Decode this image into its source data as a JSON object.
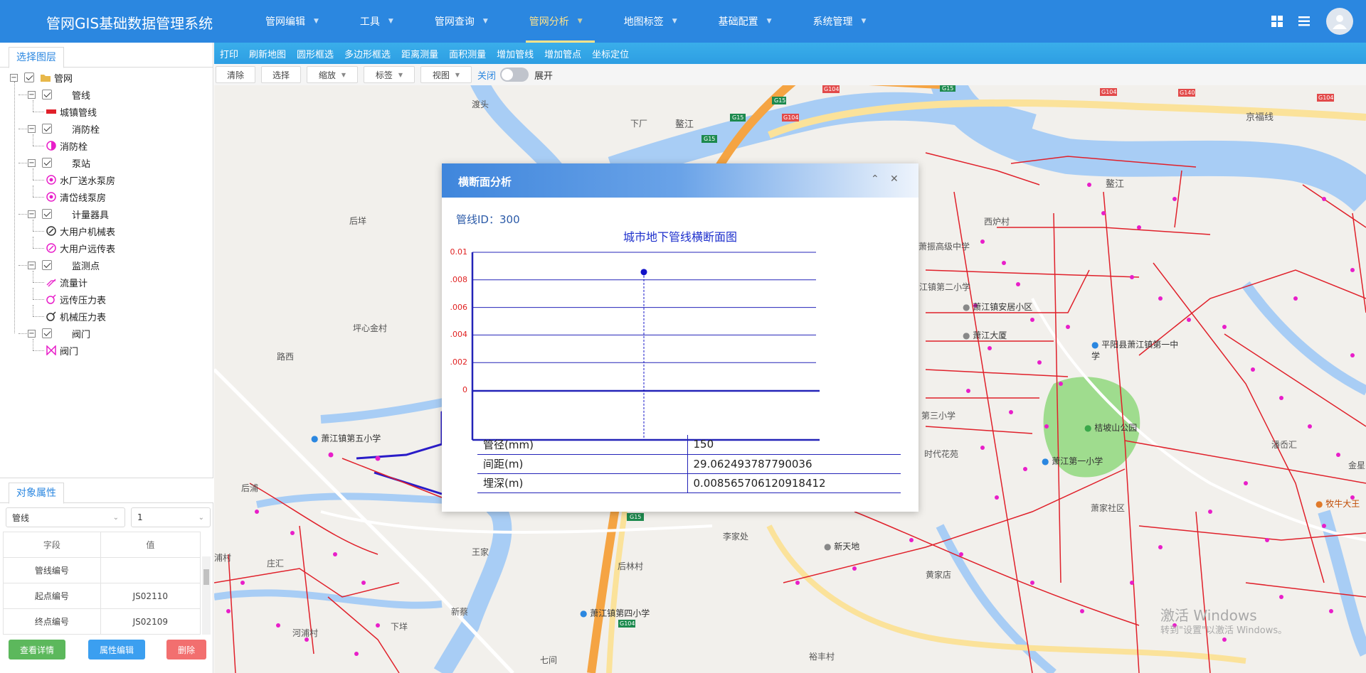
{
  "header": {
    "title": "管网GIS基础数据管理系统",
    "nav": [
      "管网编辑",
      "工具",
      "管网查询",
      "管网分析",
      "地图标签",
      "基础配置",
      "系统管理"
    ],
    "active_nav": "管网分析"
  },
  "toolbar1": [
    "打印",
    "刷新地图",
    "圆形框选",
    "多边形框选",
    "距离测量",
    "面积测量",
    "增加管线",
    "增加管点",
    "坐标定位"
  ],
  "toolbar2": {
    "clear": "清除",
    "select": "选择",
    "zoom": "缩放",
    "label": "标签",
    "view": "视图",
    "switch_off": "关闭",
    "switch_on": "展开"
  },
  "layer_panel": {
    "tab": "选择图层",
    "tree": [
      {
        "label": "管网",
        "level": 0,
        "icon": "folder-icon"
      },
      {
        "label": "管线",
        "level": 1
      },
      {
        "label": "城镇管线",
        "level": 2,
        "icon": "red-line-icon"
      },
      {
        "label": "消防栓",
        "level": 1
      },
      {
        "label": "消防栓",
        "level": 2,
        "icon": "hydrant-icon"
      },
      {
        "label": "泵站",
        "level": 1
      },
      {
        "label": "水厂送水泵房",
        "level": 2,
        "icon": "pump-icon"
      },
      {
        "label": "清岱线泵房",
        "level": 2,
        "icon": "pump-icon"
      },
      {
        "label": "计量器具",
        "level": 1
      },
      {
        "label": "大用户机械表",
        "level": 2,
        "icon": "mech-meter-icon"
      },
      {
        "label": "大用户远传表",
        "level": 2,
        "icon": "remote-meter-icon"
      },
      {
        "label": "监测点",
        "level": 1
      },
      {
        "label": "流量计",
        "level": 2,
        "icon": "flowmeter-icon"
      },
      {
        "label": "远传压力表",
        "level": 2,
        "icon": "remote-gauge-icon"
      },
      {
        "label": "机械压力表",
        "level": 2,
        "icon": "mech-gauge-icon"
      },
      {
        "label": "阀门",
        "level": 1
      },
      {
        "label": "阀门",
        "level": 2,
        "icon": "valve-icon"
      }
    ]
  },
  "attr_panel": {
    "tab": "对象属性",
    "layer_select": "管线",
    "index_select": "1",
    "columns": [
      "字段",
      "值"
    ],
    "rows": [
      [
        "管线编号",
        ""
      ],
      [
        "起点编号",
        "JS02110"
      ],
      [
        "终点编号",
        "JS02109"
      ]
    ],
    "buttons": {
      "details": "查看详情",
      "edit": "属性编辑",
      "delete": "删除"
    }
  },
  "map_labels": [
    "渡头",
    "下厂",
    "鳌江",
    "鳌江",
    "京福线",
    "后垟",
    "坪心金村",
    "路西",
    "萧江镇第五小学",
    "后浦",
    "浦村",
    "庄汇",
    "河浦村",
    "下垟",
    "新蔡",
    "七间",
    "王家",
    "后林村",
    "萧江镇第四小学",
    "李家处",
    "新天地",
    "黄家店",
    "裕丰村",
    "西炉村",
    "萧振高级中学",
    "江镇第二小学",
    "萧江镇安居小区",
    "萧江大厦",
    "平阳县萧江镇第一中学",
    "桔坡山公园",
    "萧江第一小学",
    "第三小学",
    "时代花苑",
    "潘岙汇",
    "金星",
    "牧牛大王",
    "萧家社区"
  ],
  "road_shields": [
    "G15",
    "G15",
    "G15",
    "G15",
    "G104",
    "G104",
    "G104",
    "G140",
    "G104",
    "G15",
    "G104"
  ],
  "watermark": {
    "line1": "激活 Windows",
    "line2": "转到\"设置\"以激活 Windows。"
  },
  "dialog": {
    "title": "横断面分析",
    "pipe_id_label": "管线ID：",
    "pipe_id": "300",
    "chart_title": "城市地下管线横断面图",
    "table": [
      {
        "key": "管径(mm)",
        "value": "150"
      },
      {
        "key": "间距(m)",
        "value": "29.062493787790036"
      },
      {
        "key": "埋深(m)",
        "value": "0.008565706120918412"
      }
    ]
  },
  "chart_data": {
    "type": "scatter",
    "title": "城市地下管线横断面图",
    "y_ticks": [
      "0",
      ".002",
      ".004",
      ".006",
      ".008",
      "0.01"
    ],
    "ylim": [
      0,
      0.01
    ],
    "points": [
      {
        "x": 29.062493787790036,
        "y": 0.008565706120918412
      }
    ],
    "grid": true,
    "colors": {
      "axis": "#2323b8",
      "tick_label": "#e02020",
      "point": "#1212c8"
    }
  },
  "colors": {
    "header": "#2b87e0",
    "toolbar": "#2d9ee3",
    "pipe": "#e0202a",
    "node": "#e81ec9"
  }
}
